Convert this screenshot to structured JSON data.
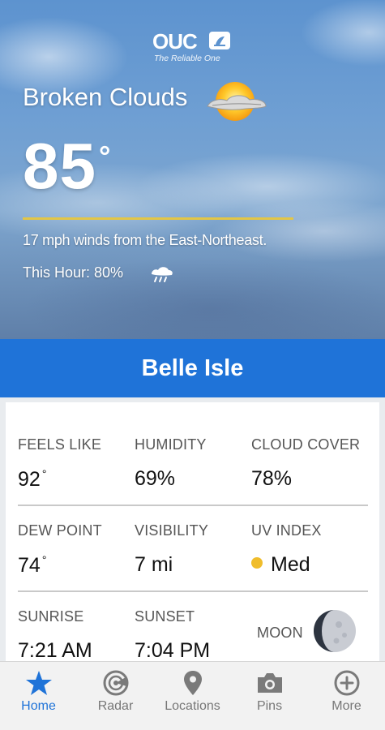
{
  "brand": {
    "logo_text": "OUC",
    "tagline": "The Reliable One"
  },
  "current": {
    "condition": "Broken Clouds",
    "condition_icon": "sun-behind-cloud-icon",
    "temperature": "85",
    "degree_symbol": "°",
    "wind": "17 mph winds from the East-Northeast.",
    "this_hour": "This Hour: 80%",
    "this_hour_icon": "rain-cloud-icon"
  },
  "location": {
    "name": "Belle Isle"
  },
  "details": {
    "feels_like": {
      "label": "FEELS LIKE",
      "value": "92"
    },
    "humidity": {
      "label": "HUMIDITY",
      "value": "69%"
    },
    "cloud_cover": {
      "label": "CLOUD COVER",
      "value": "78%"
    },
    "dew_point": {
      "label": "DEW POINT",
      "value": "74"
    },
    "visibility": {
      "label": "VISIBILITY",
      "value": "7 mi"
    },
    "uv_index": {
      "label": "UV INDEX",
      "value": "Med",
      "dot_color": "#f0bd2b"
    },
    "sunrise": {
      "label": "SUNRISE",
      "value": "7:21 AM"
    },
    "sunset": {
      "label": "SUNSET",
      "value": "7:04 PM"
    },
    "moon": {
      "label": "MOON",
      "icon": "moon-phase-icon"
    }
  },
  "nav": {
    "items": [
      {
        "label": "Home",
        "icon": "star-icon",
        "active": true
      },
      {
        "label": "Radar",
        "icon": "radar-icon",
        "active": false
      },
      {
        "label": "Locations",
        "icon": "location-pin-icon",
        "active": false
      },
      {
        "label": "Pins",
        "icon": "camera-icon",
        "active": false
      },
      {
        "label": "More",
        "icon": "plus-circle-icon",
        "active": false
      }
    ]
  },
  "colors": {
    "accent_blue": "#1f73d8",
    "temp_underline": "#e3c646",
    "uv_med": "#f0bd2b"
  }
}
